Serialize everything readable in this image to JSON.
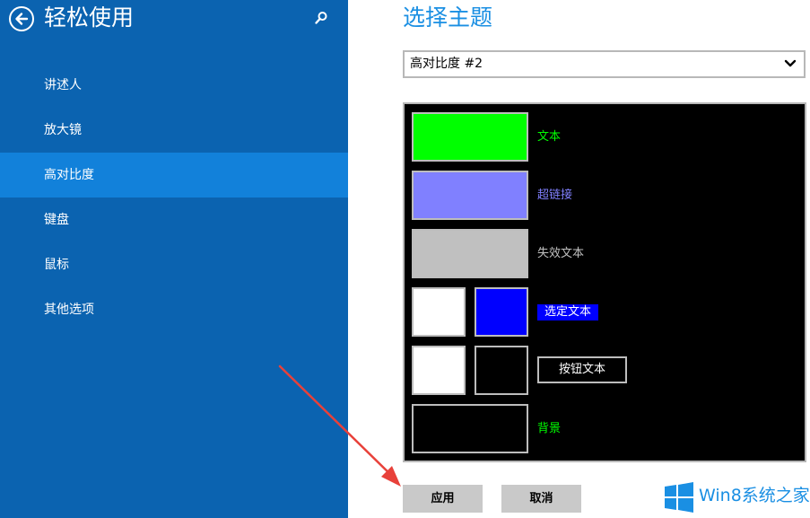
{
  "sidebar": {
    "title": "轻松使用",
    "items": [
      {
        "label": "讲述人"
      },
      {
        "label": "放大镜"
      },
      {
        "label": "高对比度"
      },
      {
        "label": "键盘"
      },
      {
        "label": "鼠标"
      },
      {
        "label": "其他选项"
      }
    ],
    "selected_item": "高对比度"
  },
  "main": {
    "title": "选择主题",
    "theme_select": {
      "value": "高对比度 #2"
    },
    "preview": {
      "text_label": "文本",
      "hyperlink_label": "超链接",
      "disabled_text_label": "失效文本",
      "selected_text_label": "选定文本",
      "button_text_label": "按钮文本",
      "background_label": "背景"
    },
    "apply_button": "应用",
    "cancel_button": "取消"
  },
  "watermark": {
    "text": "Win8系统之家"
  },
  "colors": {
    "sidebar_bg": "#0b63b0",
    "sidebar_selected": "#1281da",
    "accent": "#1a8fe3",
    "text_color": "#00ff00",
    "hyperlink_color": "#8080ff",
    "disabled_color": "#c0c0c0",
    "selected_bg": "#0000ff",
    "button_bg": "#000000",
    "background_color": "#000000",
    "arrow": "#e8413a"
  }
}
